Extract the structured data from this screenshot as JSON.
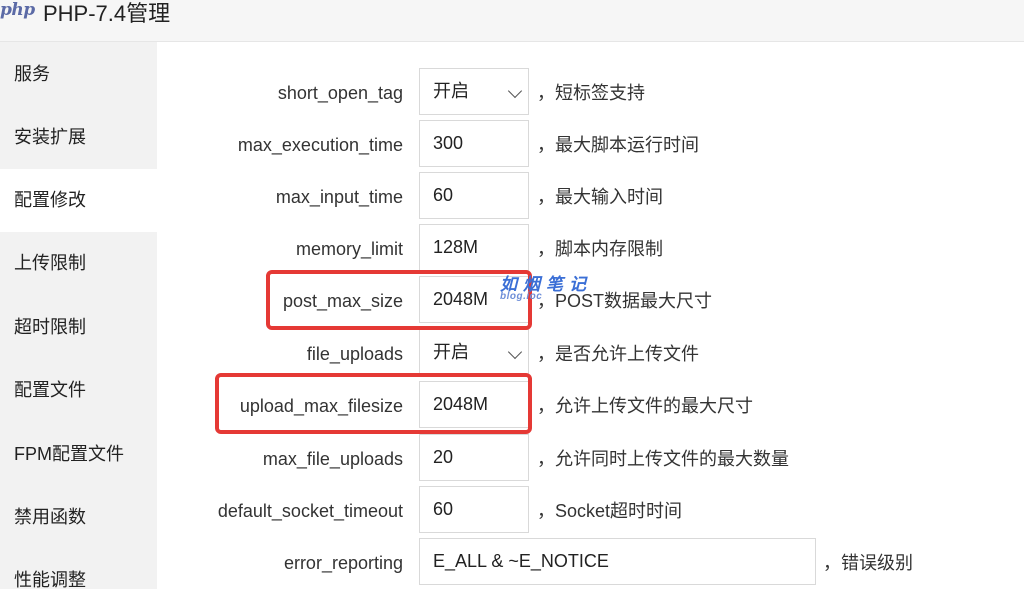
{
  "window": {
    "logo": "php",
    "title": "PHP-7.4管理"
  },
  "sidebar": {
    "items": [
      {
        "label": "服务",
        "active": false
      },
      {
        "label": "安装扩展",
        "active": false
      },
      {
        "label": "配置修改",
        "active": true
      },
      {
        "label": "上传限制",
        "active": false
      },
      {
        "label": "超时限制",
        "active": false
      },
      {
        "label": "配置文件",
        "active": false
      },
      {
        "label": "FPM配置文件",
        "active": false
      },
      {
        "label": "禁用函数",
        "active": false
      },
      {
        "label": "性能调整",
        "active": false
      }
    ]
  },
  "settings": [
    {
      "key": "short_open_tag",
      "type": "select",
      "value": "开启",
      "desc": "，短标签支持"
    },
    {
      "key": "max_execution_time",
      "type": "input",
      "value": "300",
      "desc": "，最大脚本运行时间"
    },
    {
      "key": "max_input_time",
      "type": "input",
      "value": "60",
      "desc": "，最大输入时间"
    },
    {
      "key": "memory_limit",
      "type": "input",
      "value": "128M",
      "desc": "，脚本内存限制"
    },
    {
      "key": "post_max_size",
      "type": "input",
      "value": "2048M",
      "desc": "，POST数据最大尺寸",
      "highlighted": true
    },
    {
      "key": "file_uploads",
      "type": "select",
      "value": "开启",
      "desc": "，是否允许上传文件"
    },
    {
      "key": "upload_max_filesize",
      "type": "input",
      "value": "2048M",
      "desc": "，允许上传文件的最大尺寸",
      "highlighted": true
    },
    {
      "key": "max_file_uploads",
      "type": "input",
      "value": "20",
      "desc": "，允许同时上传文件的最大数量"
    },
    {
      "key": "default_socket_timeout",
      "type": "input",
      "value": "60",
      "desc": "，Socket超时时间"
    },
    {
      "key": "error_reporting",
      "type": "input-wide",
      "value": "E_ALL & ~E_NOTICE",
      "desc": "，错误级别"
    }
  ],
  "watermark": {
    "main": "如烟笔记",
    "sub": "blog.ioc"
  },
  "colors": {
    "highlight": "#e53935",
    "sidebar_bg": "#f2f2f2",
    "watermark": "#3b6fd6"
  }
}
